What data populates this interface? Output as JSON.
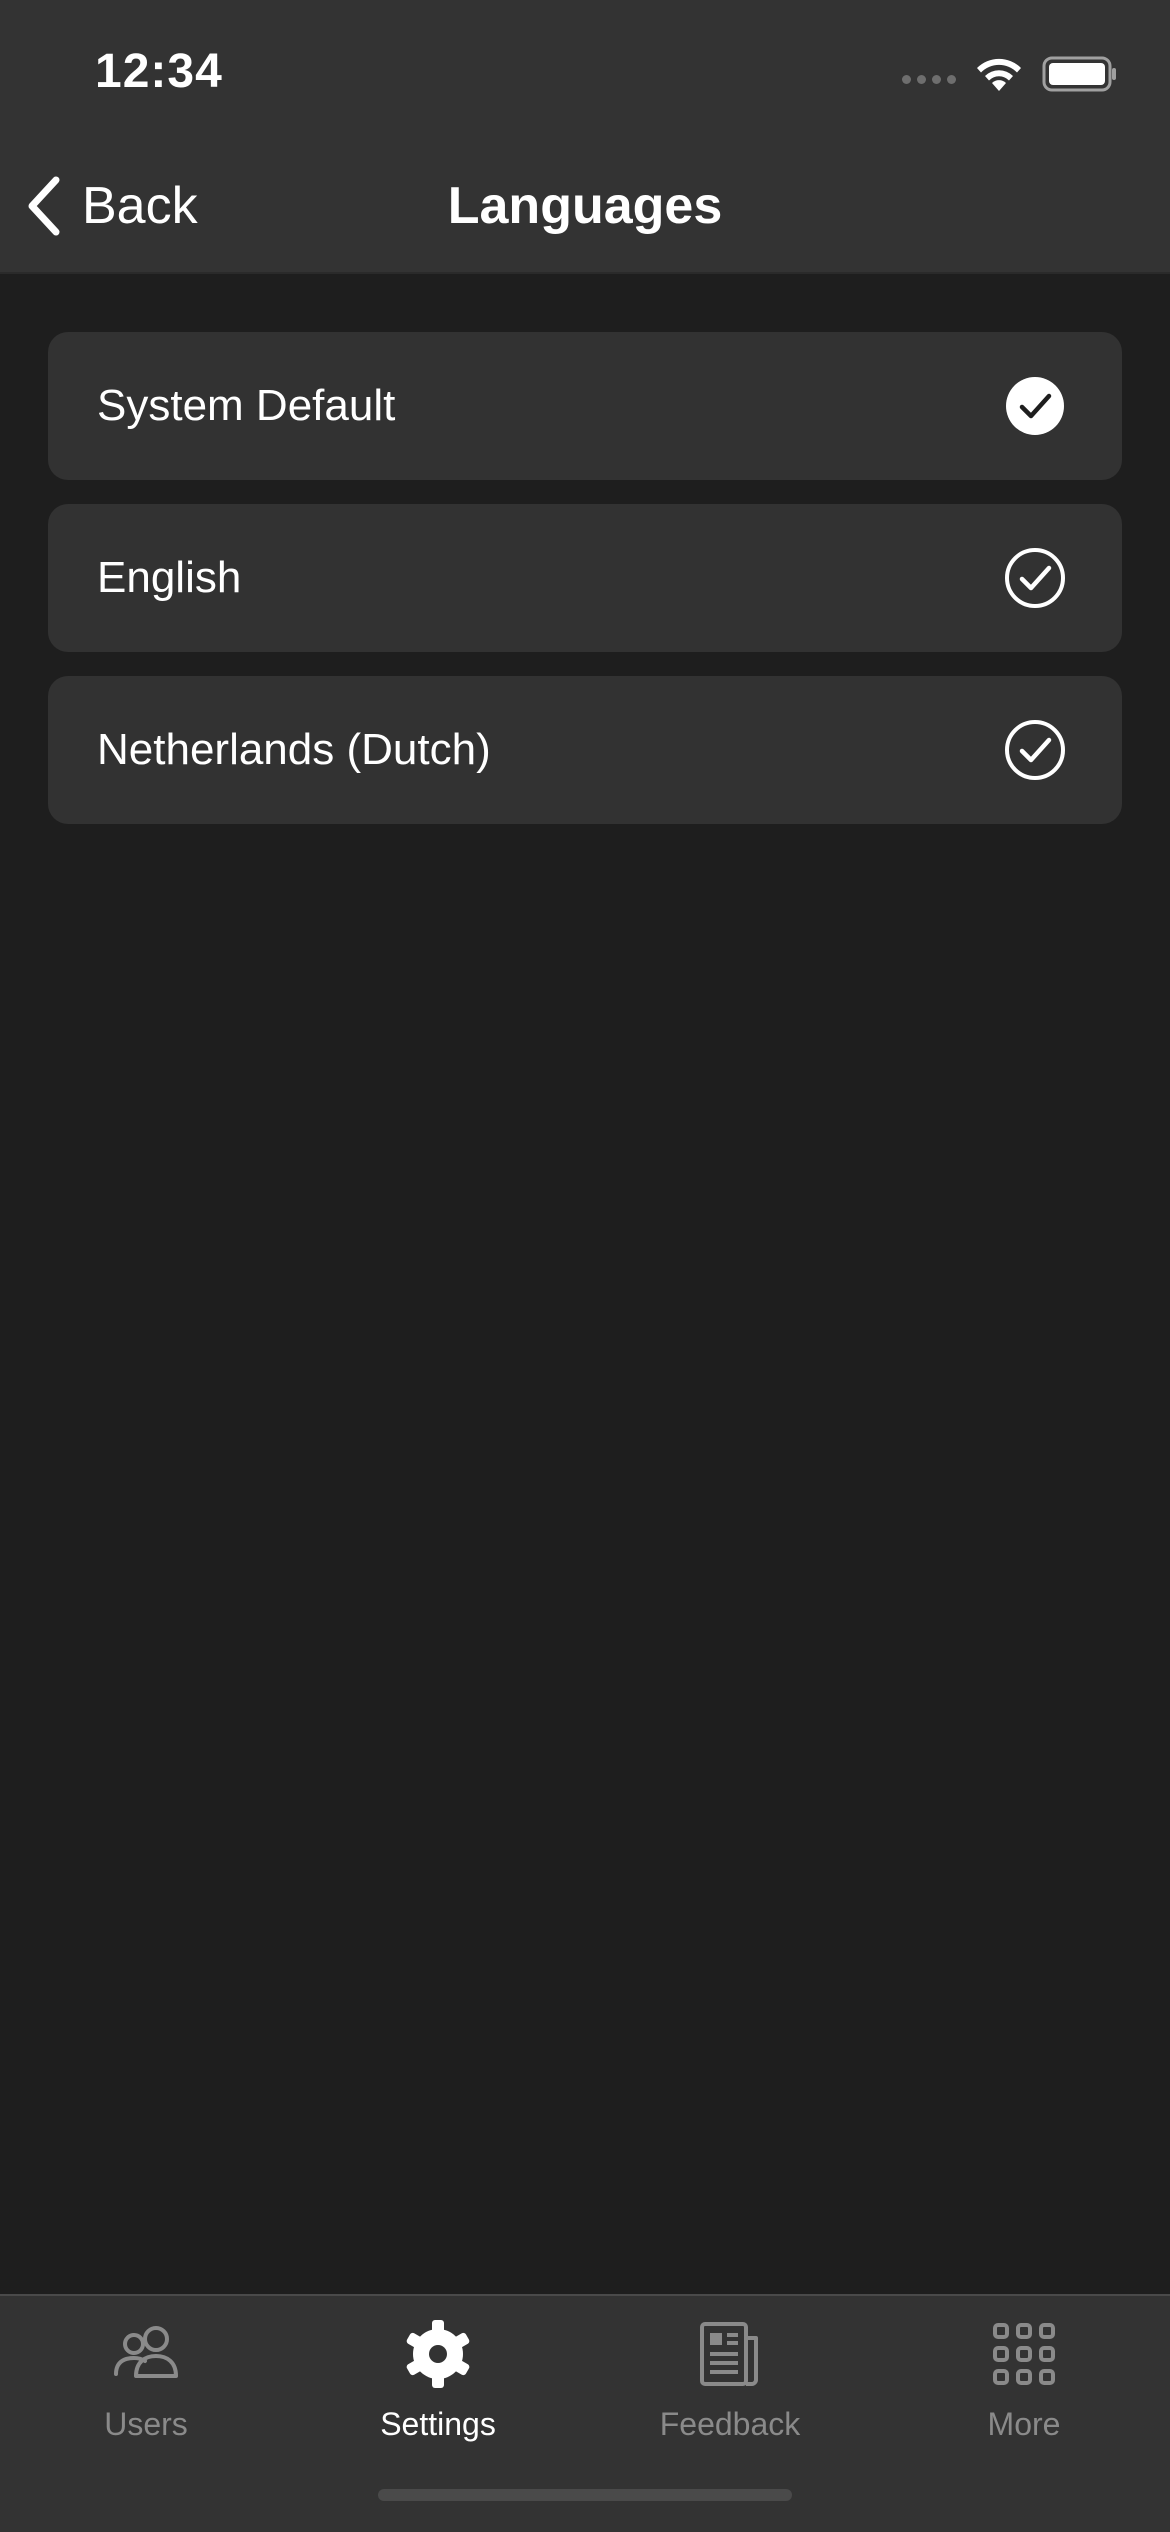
{
  "status_bar": {
    "time": "12:34"
  },
  "header": {
    "back_label": "Back",
    "title": "Languages"
  },
  "languages": [
    {
      "label": "System Default",
      "selected": true
    },
    {
      "label": "English",
      "selected": false
    },
    {
      "label": "Netherlands (Dutch)",
      "selected": false
    }
  ],
  "tabbar": {
    "tabs": [
      {
        "label": "Users",
        "icon": "users-icon",
        "active": false
      },
      {
        "label": "Settings",
        "icon": "gear-icon",
        "active": true
      },
      {
        "label": "Feedback",
        "icon": "newspaper-icon",
        "active": false
      },
      {
        "label": "More",
        "icon": "grid-icon",
        "active": false
      }
    ]
  },
  "colors": {
    "background": "#1e1e1e",
    "header": "#333333",
    "card": "#323232",
    "text": "#ffffff",
    "inactive_tab": "#8a8a8a"
  }
}
